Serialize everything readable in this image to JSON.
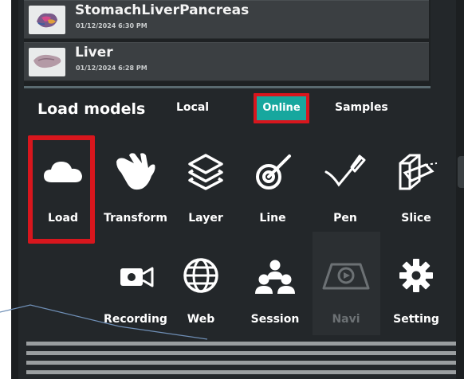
{
  "recent_models": [
    {
      "name": "StomachLiverPancreas",
      "date": "01/12/2024 6:30 PM",
      "thumb_icon": "organ-thumbnail-icon"
    },
    {
      "name": "Liver",
      "date": "01/12/2024 6:28 PM",
      "thumb_icon": "liver-thumbnail-icon"
    }
  ],
  "header": {
    "title": "Load models"
  },
  "tabs": {
    "local": "Local",
    "online": "Online",
    "samples": "Samples",
    "active": "Online"
  },
  "tools_row1": [
    {
      "label": "Load",
      "icon": "cloud-icon"
    },
    {
      "label": "Transform",
      "icon": "hand-icon"
    },
    {
      "label": "Layer",
      "icon": "layers-icon"
    },
    {
      "label": "Line",
      "icon": "line-target-icon"
    },
    {
      "label": "Pen",
      "icon": "pen-icon"
    },
    {
      "label": "Slice",
      "icon": "slice-icon"
    }
  ],
  "tools_row2": [
    {
      "label": "Recording",
      "icon": "video-camera-icon"
    },
    {
      "label": "Web",
      "icon": "globe-icon"
    },
    {
      "label": "Session",
      "icon": "users-icon"
    },
    {
      "label": "Navi",
      "icon": "navigation-icon",
      "disabled": true
    },
    {
      "label": "Setting",
      "icon": "gear-icon"
    }
  ],
  "colors": {
    "panel": "#23272a",
    "accent_teal": "#17a79e",
    "highlight_red": "#d8161d",
    "text": "#ffffff",
    "disabled_text": "#6c7174"
  }
}
